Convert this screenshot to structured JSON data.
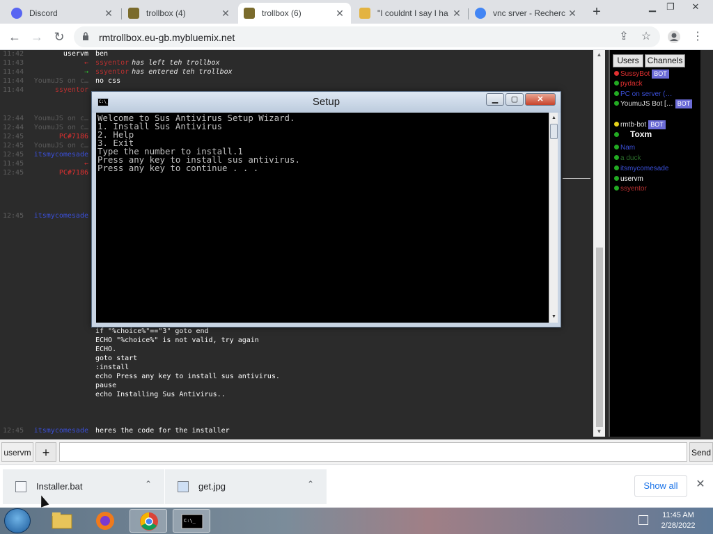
{
  "browser": {
    "tabs": [
      {
        "label": "Discord",
        "icon_color": "#5865f2",
        "active": false
      },
      {
        "label": "trollbox (4)",
        "icon_color": "#7a6b2c",
        "active": false
      },
      {
        "label": "trollbox (6)",
        "icon_color": "#7a6b2c",
        "active": true
      },
      {
        "label": "\"I couldnt I say I ha",
        "icon_color": "#e3b341",
        "active": false
      },
      {
        "label": "vnc srver - Recherc",
        "icon_color": "#4285f4",
        "active": false
      }
    ],
    "url": "rmtrollbox.eu-gb.mybluemix.net"
  },
  "chat": {
    "rows": [
      {
        "ts": "11:42",
        "nick": "uservm",
        "nick_color": "#ffffff",
        "msg": "ben"
      },
      {
        "ts": "11:43",
        "nick": "←",
        "nick_color": "#d03030",
        "sys_who": "ssyentor",
        "sys": "has left teh trollbox"
      },
      {
        "ts": "11:44",
        "nick": "→",
        "nick_color": "#30c030",
        "sys_who": "ssyentor",
        "sys": "has entered teh trollbox"
      },
      {
        "ts": "11:44",
        "nick": "YoumuJS on c…",
        "nick_color": "#5a5a5a",
        "msg": "no css"
      },
      {
        "ts": "11:44",
        "nick": "ssyentor",
        "nick_color": "#b83030",
        "msg": ""
      },
      {
        "ts": "12:44",
        "nick": "YoumuJS on c…",
        "nick_color": "#5a5a5a",
        "msg": ""
      },
      {
        "ts": "12:44",
        "nick": "YoumuJS on c…",
        "nick_color": "#5a5a5a",
        "msg": ""
      },
      {
        "ts": "12:45",
        "nick": "PC#7186",
        "nick_color": "#e03030",
        "msg": ""
      },
      {
        "ts": "12:45",
        "nick": "YoumuJS on c…",
        "nick_color": "#5a5a5a",
        "msg": ""
      },
      {
        "ts": "12:45",
        "nick": "itsmycomesade",
        "nick_color": "#3a4fd8",
        "msg": ""
      },
      {
        "ts": "11:45",
        "nick": "←",
        "nick_color": "#d03030",
        "msg": ""
      },
      {
        "ts": "12:45",
        "nick": "PC#7186",
        "nick_color": "#e03030",
        "msg": ""
      },
      {
        "ts": "12:45",
        "nick": "itsmycomesade",
        "nick_color": "#3a4fd8",
        "msg": ""
      },
      {
        "ts": "",
        "nick": "",
        "nick_color": "#ffffff",
        "msg": "if \"%choice%\"==\"3\" goto end"
      },
      {
        "ts": "",
        "nick": "",
        "nick_color": "#ffffff",
        "msg": "ECHO \"%choice%\" is not valid, try again"
      },
      {
        "ts": "",
        "nick": "",
        "nick_color": "#ffffff",
        "msg": "ECHO."
      },
      {
        "ts": "",
        "nick": "",
        "nick_color": "#ffffff",
        "msg": "goto start"
      },
      {
        "ts": "",
        "nick": "",
        "nick_color": "#ffffff",
        "msg": ":install"
      },
      {
        "ts": "",
        "nick": "",
        "nick_color": "#ffffff",
        "msg": "echo Press any key to install sus antivirus."
      },
      {
        "ts": "",
        "nick": "",
        "nick_color": "#ffffff",
        "msg": "pause"
      },
      {
        "ts": "",
        "nick": "",
        "nick_color": "#ffffff",
        "msg": "echo Installing Sus Antivirus.."
      },
      {
        "ts": "12:45",
        "nick": "itsmycomesade",
        "nick_color": "#3a4fd8",
        "msg": "heres the code for the installer"
      }
    ]
  },
  "users_panel": {
    "users_tab": "Users",
    "channels_tab": "Channels",
    "users": [
      {
        "name": "SussyBot",
        "color": "#e03030",
        "dot": "#e03030",
        "bot": true
      },
      {
        "name": "pydack",
        "color": "#e03030",
        "dot": "#22aa22",
        "bot": false
      },
      {
        "name": "PC on server (…",
        "color": "#3a4fd8",
        "dot": "#22aa22",
        "bot": false
      },
      {
        "name": "YoumuJS Bot […",
        "color": "#dddddd",
        "dot": "#22aa22",
        "bot": true
      },
      {
        "name": "rmtb-bot",
        "color": "#dddddd",
        "dot": "#e6d21a",
        "bot": true
      },
      {
        "name": "Toxm",
        "color": "#ffffff",
        "dot": "#22aa22",
        "bot": false
      },
      {
        "name": "Nam",
        "color": "#3a4fd8",
        "dot": "#22aa22",
        "bot": false
      },
      {
        "name": "a duck",
        "color": "#2a6a2a",
        "dot": "#22aa22",
        "bot": false
      },
      {
        "name": "itsmycomesade",
        "color": "#3a4fd8",
        "dot": "#22aa22",
        "bot": false
      },
      {
        "name": "uservm",
        "color": "#ffffff",
        "dot": "#22aa22",
        "bot": false
      },
      {
        "name": "ssyentor",
        "color": "#b83030",
        "dot": "#22aa22",
        "bot": false
      }
    ],
    "bot_badge": "BOT"
  },
  "input": {
    "nick": "uservm",
    "plus": "+",
    "send": "Send"
  },
  "console": {
    "title": "Setup",
    "icon_text": "C:\\_",
    "lines": [
      "Welcome to Sus Antivirus Setup Wizard.",
      "1. Install Sus Antivirus",
      "2. Help",
      "3. Exit",
      "Type the number to install.1",
      "Press any key to install sus antivirus.",
      "Press any key to continue . . ."
    ]
  },
  "downloads": {
    "items": [
      {
        "name": "Installer.bat"
      },
      {
        "name": "get.jpg"
      }
    ],
    "show_all": "Show all"
  },
  "taskbar": {
    "time": "11:45 AM",
    "date": "2/28/2022"
  }
}
